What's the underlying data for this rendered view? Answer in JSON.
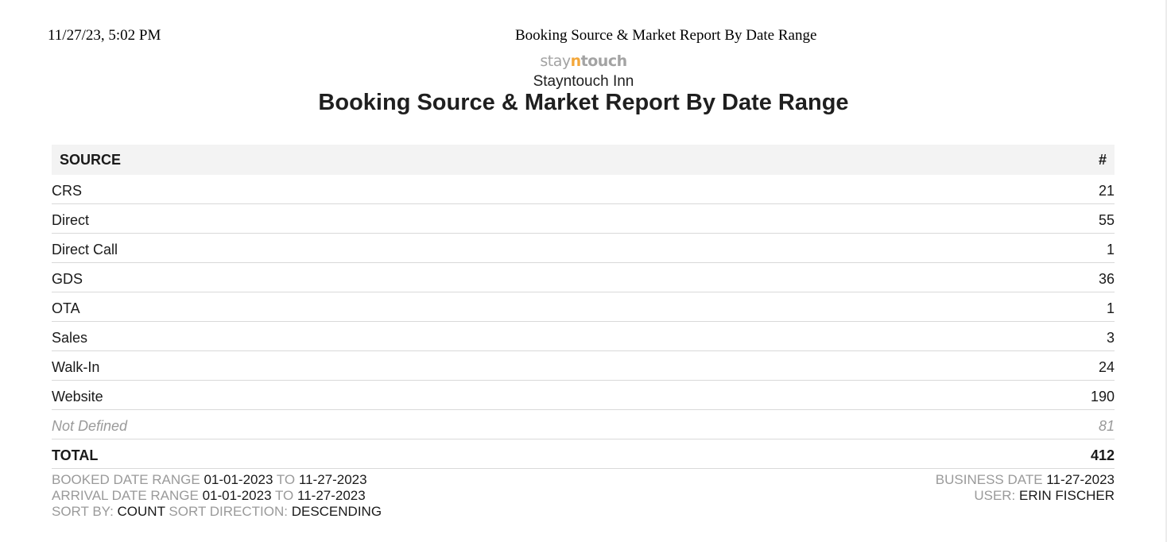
{
  "print_header": {
    "datetime": "11/27/23, 5:02 PM",
    "title": "Booking Source & Market Report By Date Range"
  },
  "logo": {
    "part1": "stay",
    "part2": "n",
    "part3": "touch",
    "colors": {
      "grey": "#a3a3a3",
      "accent": "#f3a73a"
    }
  },
  "hotel_name": "Stayntouch Inn",
  "report_title": "Booking Source & Market Report By Date Range",
  "table": {
    "headers": {
      "source": "SOURCE",
      "count": "#"
    },
    "rows": [
      {
        "source": "CRS",
        "count": "21"
      },
      {
        "source": "Direct",
        "count": "55"
      },
      {
        "source": "Direct Call",
        "count": "1"
      },
      {
        "source": "GDS",
        "count": "36"
      },
      {
        "source": "OTA",
        "count": "1"
      },
      {
        "source": "Sales",
        "count": "3"
      },
      {
        "source": "Walk-In",
        "count": "24"
      },
      {
        "source": "Website",
        "count": "190"
      },
      {
        "source": "Not Defined",
        "count": "81"
      }
    ],
    "total": {
      "label": "TOTAL",
      "count": "412"
    }
  },
  "footer": {
    "booked_label": "BOOKED DATE RANGE",
    "booked_from": "01-01-2023",
    "to_label": "TO",
    "booked_to": "11-27-2023",
    "arrival_label": "ARRIVAL DATE RANGE",
    "arrival_from": "01-01-2023",
    "arrival_to": "11-27-2023",
    "sort_by_label": "SORT BY:",
    "sort_by": "COUNT",
    "sort_dir_label": "SORT DIRECTION:",
    "sort_dir": "DESCENDING",
    "business_date_label": "BUSINESS DATE",
    "business_date": "11-27-2023",
    "user_label": "USER:",
    "user": "ERIN FISCHER"
  }
}
